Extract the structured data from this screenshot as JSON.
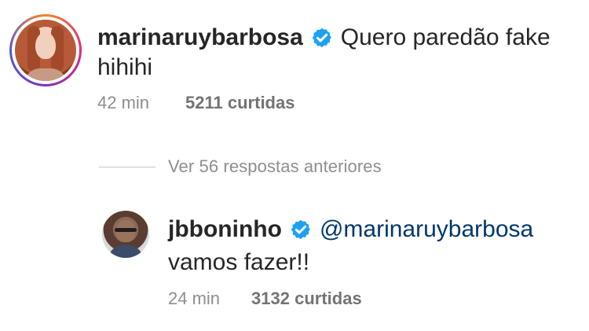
{
  "comment_top": {
    "avatar_icon": "profile-photo-marina-icon",
    "username": "marinaruybarbosa",
    "verified_icon": "verified-badge-icon",
    "text_line1": "Quero paredão fake",
    "text_line2": "hihihi",
    "time": "42 min",
    "likes": "5211 curtidas"
  },
  "replies": {
    "label": "Ver 56 respostas anteriores"
  },
  "comment_reply": {
    "avatar_icon": "profile-photo-boninho-icon",
    "username": "jbboninho",
    "verified_icon": "verified-badge-icon",
    "mention": "@marinaruybarbosa",
    "text_line2": "vamos fazer!!",
    "time": "24 min",
    "likes": "3132 curtidas"
  },
  "colors": {
    "text": "#262626",
    "meta": "#8e8e8e",
    "mention": "#00376b",
    "verified": "#1da1f2",
    "divider": "#c7c7c7"
  }
}
